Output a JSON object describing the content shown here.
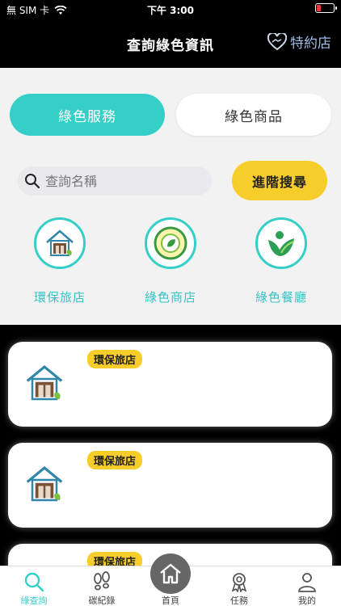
{
  "status_bar": {
    "carrier": "無 SIM 卡",
    "time": "下午 3:00"
  },
  "header": {
    "title": "查詢綠色資訊",
    "partner_label": "特約店"
  },
  "segments": {
    "active": "綠色服務",
    "inactive": "綠色商品"
  },
  "search": {
    "placeholder": "查詢名稱",
    "advanced_button": "進階搜尋"
  },
  "categories": [
    "環保旅店",
    "綠色商店",
    "綠色餐廳"
  ],
  "cards": [
    {
      "badge": "環保旅店"
    },
    {
      "badge": "環保旅店"
    },
    {
      "badge": "環保旅店"
    }
  ],
  "tabbar": {
    "tabs": [
      {
        "label": "綠查詢",
        "icon": "search-icon"
      },
      {
        "label": "碳紀錄",
        "icon": "footprints-icon"
      },
      {
        "label": "首頁",
        "icon": "home-icon"
      },
      {
        "label": "任務",
        "icon": "award-icon"
      },
      {
        "label": "我的",
        "icon": "person-icon"
      }
    ]
  },
  "colors": {
    "accent": "#35cfc8",
    "badge": "#f6cd2a",
    "header_bg": "#000000",
    "panel_bg": "#f2f2f2"
  }
}
